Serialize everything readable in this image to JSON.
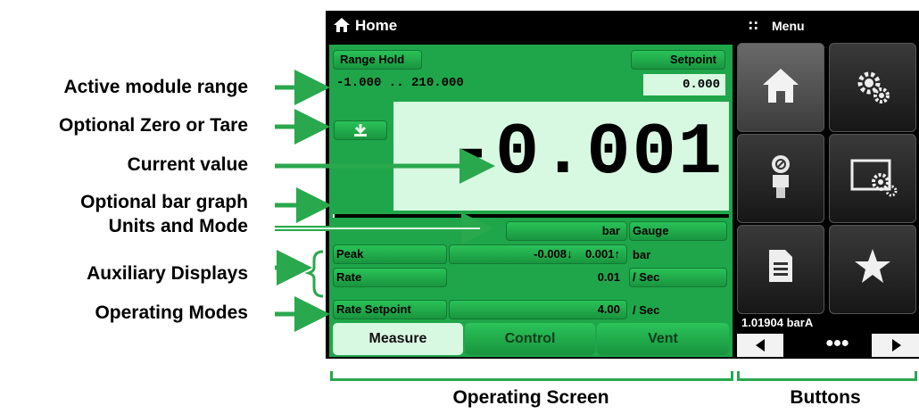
{
  "annotations": {
    "active_range": "Active module range",
    "zero_tare": "Optional Zero or Tare",
    "current_value": "Current value",
    "bar_graph": "Optional bar graph",
    "units_mode": "Units and Mode",
    "aux_displays": "Auxiliary Displays",
    "op_modes": "Operating Modes"
  },
  "titlebar": {
    "home_label": "Home",
    "menu_label": "Menu"
  },
  "operating": {
    "range_hold_label": "Range Hold",
    "setpoint_label": "Setpoint",
    "range_text": "-1.000 .. 210.000",
    "setpoint_value": "0.000",
    "current_value": "-0.001",
    "bar_fill_fraction": 0.005,
    "units": "bar",
    "mode": "Gauge",
    "aux": [
      {
        "label": "Peak",
        "value": "-0.008↓    0.001↑",
        "unit": "bar"
      },
      {
        "label": "Rate",
        "value": "0.01",
        "unit": "/ Sec"
      }
    ],
    "mode_row": {
      "label": "Rate Setpoint",
      "value": "4.00",
      "unit": "/ Sec"
    },
    "tabs": [
      "Measure",
      "Control",
      "Vent"
    ]
  },
  "buttons_panel": {
    "icons": [
      "home-icon",
      "settings-gears-icon",
      "sensor-module-icon",
      "display-settings-icon",
      "document-icon",
      "star-icon"
    ],
    "barometer_reading": "1.01904 barA"
  },
  "bottom": {
    "operating_screen": "Operating Screen",
    "buttons": "Buttons"
  },
  "colors": {
    "screen_green": "#1fa64a",
    "light_green": "#d8f9e1",
    "arrow_green": "#2aa84d"
  }
}
